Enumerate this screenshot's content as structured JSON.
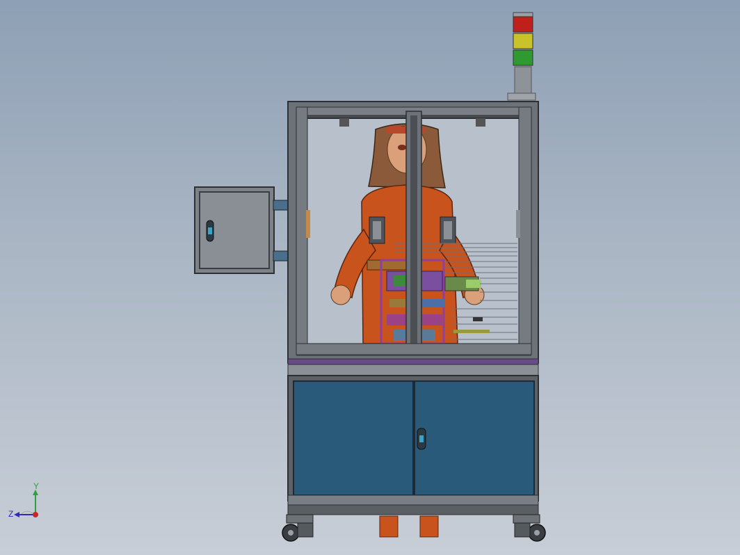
{
  "viewport": {
    "background_top": "#8ea0b5",
    "background_bottom": "#c8ced7"
  },
  "triad": {
    "y_label": "Y",
    "z_label": "Z",
    "y_color": "#2ea043",
    "z_color": "#2b2bbd",
    "x_color": "#c62828"
  },
  "stack_light": {
    "colors": [
      "#c0201a",
      "#c9c228",
      "#2f9a2f"
    ]
  },
  "colors": {
    "frame": "#5f6368",
    "frame_dark": "#3b3e42",
    "cabinet_door": "#2a5a7a",
    "glass": "#b9c1cc",
    "operator": "#c9531c",
    "fixture_purple": "#8e3fa0"
  }
}
